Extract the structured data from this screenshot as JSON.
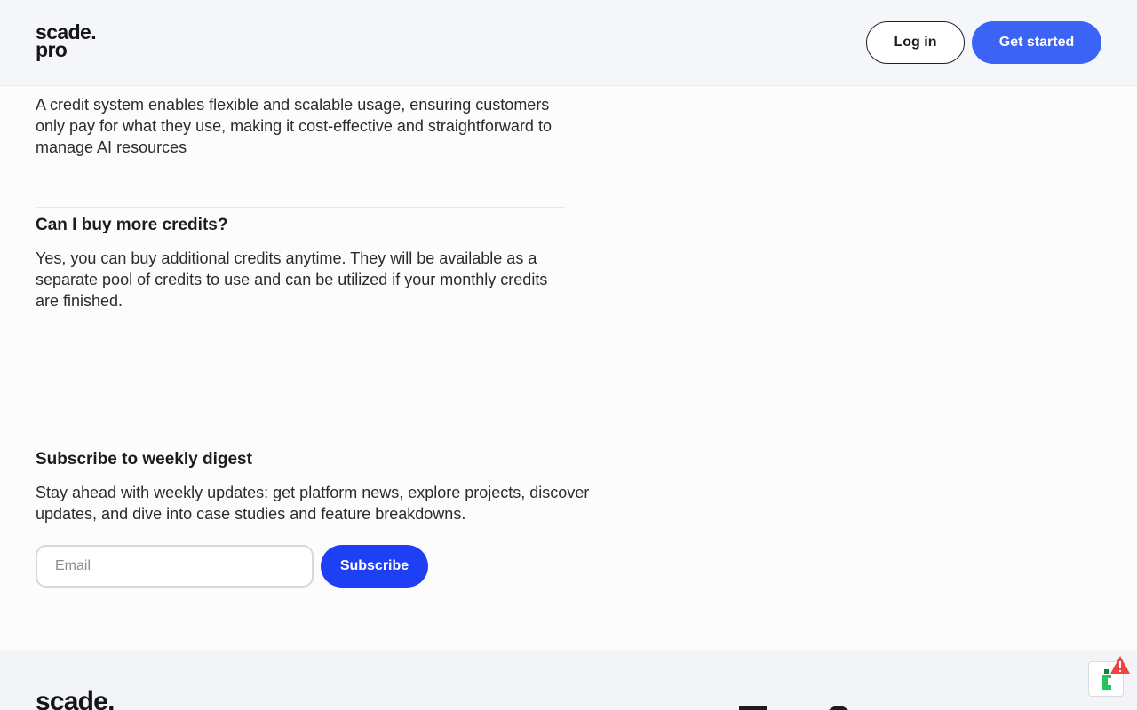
{
  "header": {
    "logo_line1": "scade.",
    "logo_line2": "pro",
    "login_label": "Log in",
    "get_started_label": "Get started"
  },
  "faq": {
    "answer_1": "A credit system enables flexible and scalable usage, ensuring customers only pay for what they use, making it cost-effective and straightforward to manage AI resources",
    "question_2": "Can I buy more credits?",
    "answer_2": "Yes, you can buy additional credits anytime. They will be available as a separate pool of credits to use and can be utilized if your monthly credits are finished."
  },
  "subscribe": {
    "title": "Subscribe to weekly digest",
    "text": "Stay ahead with weekly updates: get platform news, explore projects, discover updates, and dive into case studies and feature breakdowns.",
    "email_placeholder": "Email",
    "button_label": "Subscribe"
  },
  "footer": {
    "logo": "scade."
  },
  "icons": {
    "widget": "bottle-icon",
    "alert": "warning-icon"
  },
  "colors": {
    "primary": "#3b63f5",
    "subscribe_button": "#1f3ff5",
    "alert": "#ef4444",
    "widget_accent": "#22c55e"
  }
}
